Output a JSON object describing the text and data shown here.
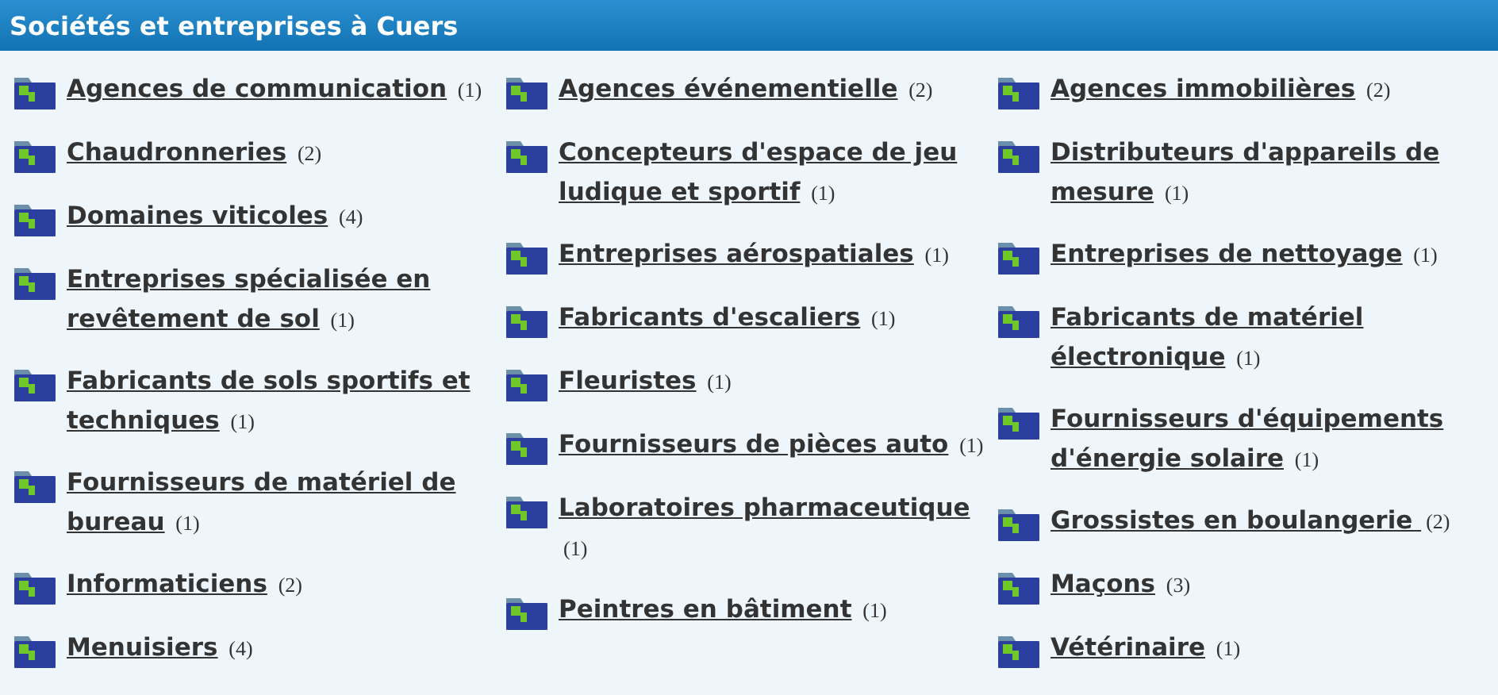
{
  "header": {
    "title": "Sociétés et entreprises à Cuers"
  },
  "columns": [
    [
      {
        "label": "Agences de communication",
        "count": "(1)"
      },
      {
        "label": "Chaudronneries",
        "count": "(2)"
      },
      {
        "label": "Domaines viticoles",
        "count": "(4)"
      },
      {
        "label": "Entreprises spécialisée en revêtement de sol",
        "count": "(1)"
      },
      {
        "label": "Fabricants de sols sportifs et techniques",
        "count": "(1)"
      },
      {
        "label": "Fournisseurs de matériel de bureau",
        "count": "(1)"
      },
      {
        "label": "Informaticiens",
        "count": "(2)"
      },
      {
        "label": "Menuisiers",
        "count": "(4)"
      }
    ],
    [
      {
        "label": "Agences événementielle",
        "count": "(2)"
      },
      {
        "label": "Concepteurs d'espace de jeu ludique et sportif",
        "count": "(1)"
      },
      {
        "label": "Entreprises aérospatiales",
        "count": "(1)"
      },
      {
        "label": "Fabricants d'escaliers",
        "count": "(1)"
      },
      {
        "label": "Fleuristes",
        "count": "(1)"
      },
      {
        "label": "Fournisseurs de pièces auto",
        "count": "(1)"
      },
      {
        "label": "Laboratoires pharmaceutique",
        "count": "(1)"
      },
      {
        "label": "Peintres en bâtiment",
        "count": "(1)"
      }
    ],
    [
      {
        "label": "Agences immobilières",
        "count": "(2)"
      },
      {
        "label": "Distributeurs d'appareils de mesure",
        "count": "(1)"
      },
      {
        "label": "Entreprises de nettoyage",
        "count": "(1)"
      },
      {
        "label": "Fabricants de matériel électronique",
        "count": "(1)"
      },
      {
        "label": "Fournisseurs d'équipements d'énergie solaire",
        "count": "(1)"
      },
      {
        "label": "Grossistes en boulangerie ",
        "count": "(2)"
      },
      {
        "label": "Maçons",
        "count": "(3)"
      },
      {
        "label": "Vétérinaire",
        "count": "(1)"
      }
    ]
  ]
}
